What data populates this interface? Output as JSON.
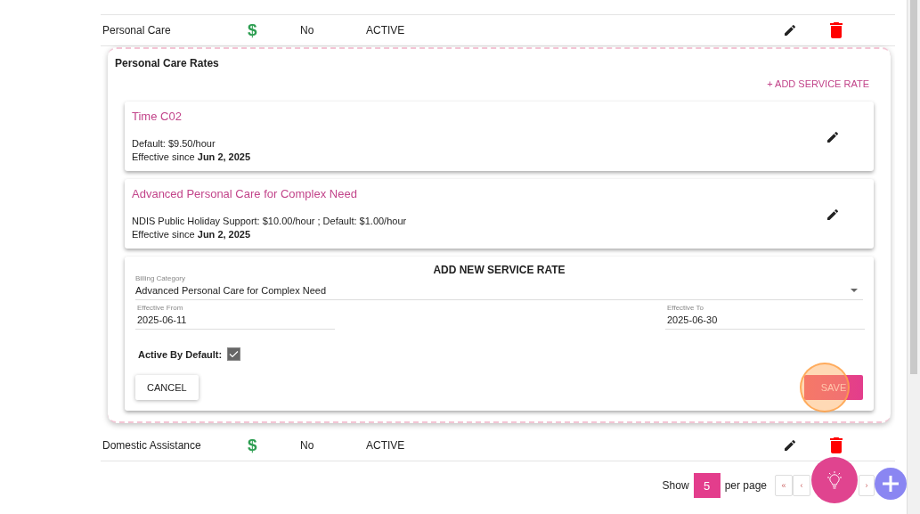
{
  "rows": [
    {
      "name": "Personal Care",
      "rate_icon": "$",
      "funded": "No",
      "status": "ACTIVE",
      "expanded": true
    },
    {
      "name": "Domestic Assistance",
      "rate_icon": "$",
      "funded": "No",
      "status": "ACTIVE",
      "expanded": false
    }
  ],
  "rates_panel": {
    "title": "Personal Care Rates",
    "add_link": "+ ADD SERVICE RATE",
    "rates": [
      {
        "name": "Time C02",
        "pricing": "Default: $9.50/hour",
        "effective": "Effective since **Jun 2, 2025**"
      },
      {
        "name": "Advanced Personal Care for Complex Need",
        "pricing": "NDIS Public Holiday Support: $10.00/hour ; Default: $1.00/hour",
        "effective": "Effective since **Jun 2, 2025**"
      }
    ],
    "form": {
      "title": "ADD NEW SERVICE RATE",
      "billing_category": {
        "label": "Billing Category",
        "value": "Advanced Personal Care for Complex Need"
      },
      "effective_from": {
        "label": "Effective From",
        "value": "2025-06-11"
      },
      "effective_to": {
        "label": "Effective To",
        "value": "2025-06-30"
      },
      "active_by_default": {
        "label": "Active By Default:",
        "checked": true
      },
      "buttons": [
        {
          "label": "CANCEL",
          "kind": "secondary"
        },
        {
          "label": "SAVE",
          "kind": "primary"
        }
      ]
    }
  },
  "pagination": {
    "show": "Show",
    "page_size": "5",
    "per_page": "per page",
    "buttons": [
      "«",
      "‹",
      "›"
    ]
  }
}
